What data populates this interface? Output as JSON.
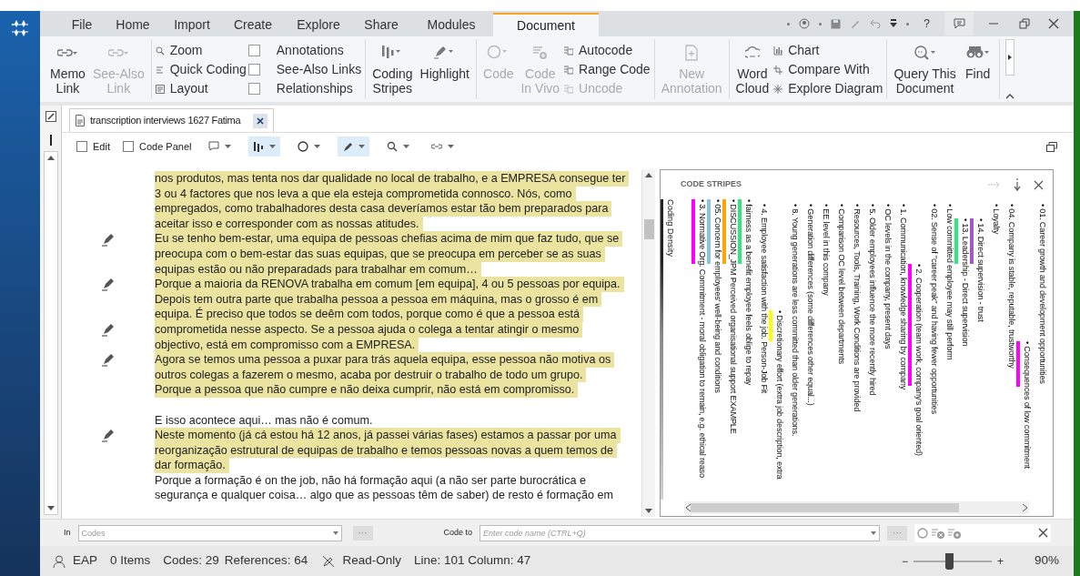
{
  "tabs": [
    {
      "label": "File",
      "selected": false
    },
    {
      "label": "Home",
      "selected": false
    },
    {
      "label": "Import",
      "selected": false
    },
    {
      "label": "Create",
      "selected": false
    },
    {
      "label": "Explore",
      "selected": false
    },
    {
      "label": "Share",
      "selected": false
    },
    {
      "label": "Modules",
      "selected": false
    },
    {
      "label": "Document",
      "selected": true
    }
  ],
  "title_bar": {
    "help": "?"
  },
  "ribbon": {
    "groups": [
      {
        "items": [
          {
            "kind": "large",
            "lines": [
              "Memo",
              "Link"
            ],
            "disabled": false
          },
          {
            "kind": "large",
            "lines": [
              "See-Also",
              "Link"
            ],
            "disabled": true
          }
        ]
      },
      {
        "items": [
          {
            "kind": "small",
            "label": "Zoom",
            "disabled": false
          },
          {
            "kind": "small",
            "label": "Quick Coding",
            "disabled": false
          },
          {
            "kind": "small",
            "label": "Layout",
            "disabled": false
          },
          {
            "kind": "check",
            "label": "Annotations",
            "checked": false
          },
          {
            "kind": "check",
            "label": "See-Also Links",
            "checked": false
          },
          {
            "kind": "check",
            "label": "Relationships",
            "checked": false
          }
        ]
      },
      {
        "items": [
          {
            "kind": "large",
            "lines": [
              "Coding",
              "Stripes"
            ],
            "disabled": false
          },
          {
            "kind": "large",
            "lines": [
              "Highlight"
            ],
            "disabled": false
          }
        ]
      },
      {
        "items": [
          {
            "kind": "large",
            "lines": [
              "Code"
            ],
            "disabled": true
          },
          {
            "kind": "large",
            "lines": [
              "Code",
              "In Vivo"
            ],
            "disabled": true
          },
          {
            "kind": "small",
            "label": "Autocode",
            "disabled": false
          },
          {
            "kind": "small",
            "label": "Range Code",
            "disabled": false
          },
          {
            "kind": "small",
            "label": "Uncode",
            "disabled": true
          }
        ]
      },
      {
        "items": [
          {
            "kind": "large",
            "lines": [
              "New",
              "Annotation"
            ],
            "disabled": true
          }
        ]
      },
      {
        "items": [
          {
            "kind": "large",
            "lines": [
              "Word",
              "Cloud"
            ],
            "disabled": false
          },
          {
            "kind": "small",
            "label": "Chart",
            "disabled": false
          },
          {
            "kind": "small",
            "label": "Compare With",
            "disabled": false
          },
          {
            "kind": "small",
            "label": "Explore Diagram",
            "disabled": false
          }
        ]
      },
      {
        "items": [
          {
            "kind": "large",
            "lines": [
              "Query This",
              "Document"
            ],
            "disabled": false
          },
          {
            "kind": "large",
            "lines": [
              "Find"
            ],
            "disabled": false
          }
        ]
      }
    ]
  },
  "document_tab": {
    "title": "transcription interviews 1627 Fatima"
  },
  "doc_toolbar": {
    "checkboxes": [
      {
        "label": "Edit",
        "checked": false
      },
      {
        "label": "Code Panel",
        "checked": false
      }
    ],
    "tools": [
      {
        "selected": false
      },
      {
        "selected": true
      },
      {
        "selected": false
      },
      {
        "selected": true
      },
      {
        "selected": false
      },
      {
        "selected": false
      }
    ]
  },
  "document": {
    "lines": [
      {
        "text": "nos produtos, mas tenta nos dar qualidade no local de trabalho, e a EMPRESA consegue ter",
        "highlighted": true,
        "annotated": false
      },
      {
        "text": "3 ou 4 factores que nos leva a que ela esteja comprometida connosco. Nós, como",
        "highlighted": true,
        "annotated": false
      },
      {
        "text": "empregados, como trabalhadores desta casa deveríamos estar tão bem preparados para",
        "highlighted": true,
        "annotated": false
      },
      {
        "text": "aceitar isso e corresponder com as nossas atitudes.",
        "highlighted": true,
        "annotated": false
      },
      {
        "text": "Eu se tenho bem-estar, uma equipa de pessoas chefias acima de mim que faz tudo, que se",
        "highlighted": true,
        "annotated": true
      },
      {
        "text": "preocupa com o bem-estar das suas equipas, que se preocupa em perceber se as suas",
        "highlighted": true,
        "annotated": false
      },
      {
        "text": "equipas estão ou não preparadads para trabalhar em comum…",
        "highlighted": true,
        "annotated": false
      },
      {
        "text": "Porque a maioria da RENOVA trabalha em comum [em equipa], 4 ou 5 pessoas por equipa.",
        "highlighted": true,
        "annotated": true
      },
      {
        "text": "Depois tem outra parte que trabalha pessoa a pessoa em máquina, mas o grosso é em",
        "highlighted": true,
        "annotated": false
      },
      {
        "text": "equipa. É preciso que todos se deêm com todos, porque como é que a pessoa está",
        "highlighted": true,
        "annotated": false
      },
      {
        "text": "comprometida nesse aspecto. Se a pessoa ajuda o colega a tentar atingir o mesmo",
        "highlighted": true,
        "annotated": true
      },
      {
        "text": "objectivo, está em compromisso com a EMPRESA.",
        "highlighted": true,
        "annotated": false
      },
      {
        "text": "Agora se temos uma pessoa a puxar para trás aquela equipa, esse pessoa não motiva os",
        "highlighted": true,
        "annotated": true
      },
      {
        "text": "outros colegas a fazerem o mesmo, acaba por destruir o trabalho de todo um grupo.",
        "highlighted": true,
        "annotated": false
      },
      {
        "text": "Porque a pessoa que não cumpre e não deixa cumprir, não está em compromisso.",
        "highlighted": true,
        "annotated": false
      },
      {
        "text": "E isso acontece aqui… mas não é comum.",
        "highlighted": false,
        "annotated": false,
        "space_before": true
      },
      {
        "text": "Neste momento (já cá estou há 12 anos, já passei várias fases) estamos a passar por uma",
        "highlighted": true,
        "annotated": true
      },
      {
        "text": "reorganização estrutural de equipas de trabalho e temos pessoas novas a quem temos de",
        "highlighted": true,
        "annotated": false
      },
      {
        "text": "dar formação.",
        "highlighted": true,
        "annotated": false
      },
      {
        "text": "Porque a formação é on the job, não há formação aqui (a não ser parte burocrática e",
        "highlighted": false,
        "annotated": false
      },
      {
        "text": "segurança e qualquer coisa… algo que as pessoas têm de saber) de resto é formação em",
        "highlighted": false,
        "annotated": false
      }
    ]
  },
  "code_stripes": {
    "title": "CODE STRIPES",
    "stripes": [
      {
        "label": "• 01. Career growth and development opportunities"
      },
      {
        "label": "• Consequences of low commitment",
        "color": "#ff00ff"
      },
      {
        "label": "• 04. Company is stable, reputable, trustworthy"
      },
      {
        "label": "• Loyalty"
      },
      {
        "label": "• 14. Direct supervision - trust",
        "color": "#a259c4"
      },
      {
        "label": "• 13. Leadership - Direct supervision",
        "color": "#2ee87a"
      },
      {
        "label": "• Low committed employee may still perform"
      },
      {
        "label": "• 02. Sense of \"career peak\" and having fewer opportunities"
      },
      {
        "label": "• 2. Cooperation (team work, company's goal oriented)",
        "color": "#ff00ff"
      },
      {
        "label": "• 1. Communication, knowledge sharing by company"
      },
      {
        "label": "• OC levels in the company, present days"
      },
      {
        "label": "• 5. Older employees influence the more recently hired"
      },
      {
        "label": "• Resources, Tools, Training, Work Conditions are provided"
      },
      {
        "label": "• Comparison OC level between departments"
      },
      {
        "label": "• EE level in this company"
      },
      {
        "label": "• Generation differences (some differences other equal...)"
      },
      {
        "label": "• 8. Young generations are less committed than older generations."
      },
      {
        "label": "• Discretionary effort (extra job description, extra",
        "color": "#ffff00"
      },
      {
        "label": "• 4. Employee satisfaction with the job. Person-Job Fit"
      },
      {
        "label": "• fairness as a benefit employee feels oblige to repay",
        "color": "#2ee87a"
      },
      {
        "label": "• DISCUSSION_JPM Perceived organisational support EXAMPLE",
        "color": "#ffa500"
      },
      {
        "label": "• 05. Concern for employees' well-being and conditions",
        "color": "#87c5e8"
      },
      {
        "label": "• 3. Normative Org. Commitment - moral obligation to remain, e.g. ethical reaso",
        "color": "#ff00ff"
      }
    ],
    "density_label": "Coding Density"
  },
  "find_bar": {
    "in_label": "In",
    "in_placeholder": "Codes",
    "in_more": "···",
    "code_to_label": "Code to",
    "code_placeholder": "Enter code name (CTRL+Q)",
    "code_more": "···"
  },
  "status_bar": {
    "user": "EAP",
    "items": "0 Items",
    "codes": "Codes: 29",
    "references": "References: 64",
    "mode": "Read-Only",
    "position": "Line: 101 Column: 47",
    "zoom_minus": "−",
    "zoom_plus": "+",
    "zoom": {
      "level": 0.45
    },
    "zoom_value": "90%"
  }
}
